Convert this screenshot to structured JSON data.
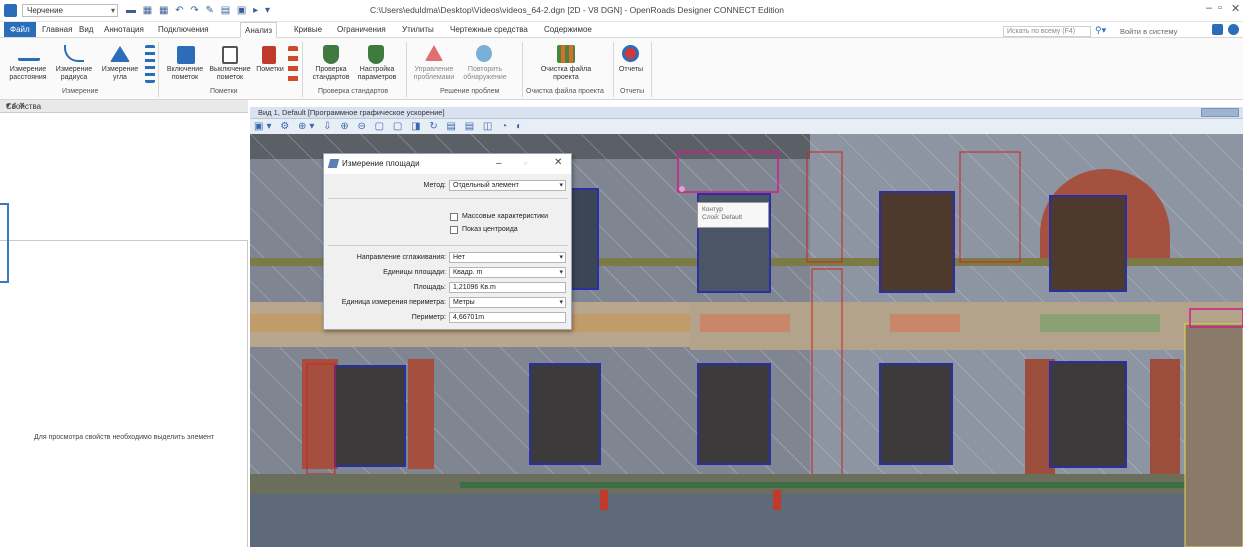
{
  "titlebar": {
    "workspace": "Черчение",
    "title": "C:\\Users\\eduldma\\Desktop\\Videos\\videos_64-2.dgn [2D - V8 DGN] - OpenRoads Designer CONNECT Edition",
    "min": "–",
    "max": "▫",
    "close": "✕"
  },
  "menu": {
    "tabs": [
      "Файл",
      "Главная",
      "Вид",
      "Аннотация",
      "Подключения",
      "Анализ",
      "Кривые",
      "Ограничения",
      "Утилиты",
      "Чертежные средства",
      "Содержимое"
    ],
    "search_placeholder": "Искать по всему (F4)",
    "signin": "Войти в систему"
  },
  "ribbon": {
    "measure_distance": "Измерение расстояния",
    "measure_radius": "Измерение радиуса",
    "measure_angle": "Измерение угла",
    "group_measure": "Измерение",
    "enable_markers": "Включение пометок",
    "disable_markers": "Выключение пометок",
    "markers": "Пометки",
    "group_markers": "Пометки",
    "check_standards": "Проверка стандартов",
    "configure_params": "Настройка параметров",
    "group_standards": "Проверка стандартов",
    "manage_problems": "Управление проблемами",
    "repeat_problems": "Повторить обнаружение",
    "group_problems": "Решение проблем",
    "cleanup_file": "Очистка файла проекта",
    "group_cleanup": "Очистка файла проекта",
    "reports": "Отчеты",
    "group_reports": "Отчеты"
  },
  "properties": {
    "title": "Свойства",
    "pin": "▾ ♯ ✕",
    "empty_message": "Для просмотра свойств необходимо выделить элемент"
  },
  "view": {
    "title": "Вид 1, Default [Программное графическое ускорение]"
  },
  "dialog": {
    "title": "Измерение площади",
    "method_label": "Метод:",
    "method_value": "Отдельный элемент",
    "mass_props_label": "Массовые характеристики",
    "show_centroid_label": "Показ центроида",
    "smoothing_label": "Направление сглаживания:",
    "smoothing_value": "Нет",
    "area_units_label": "Единицы площади:",
    "area_units_value": "Квадр. m",
    "area_label": "Площадь:",
    "area_value": "1,21096 Кв.m",
    "perimeter_units_label": "Единица измерения периметра:",
    "perimeter_units_value": "Метры",
    "perimeter_label": "Периметр:",
    "perimeter_value": "4,66701m"
  },
  "tooltip": {
    "line1": "Контур",
    "line2": "Слой: Default"
  }
}
